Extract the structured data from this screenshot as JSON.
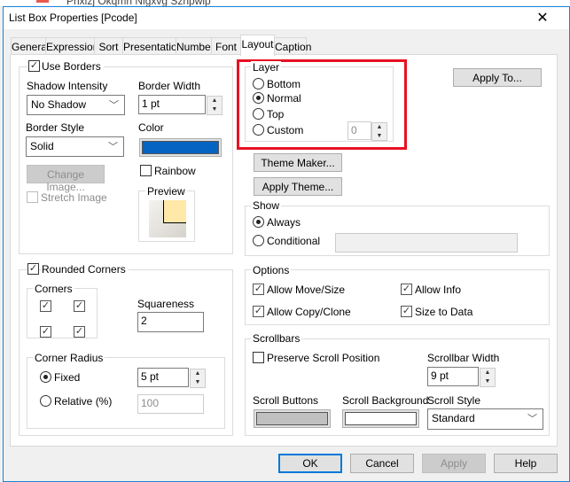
{
  "background": {
    "partial_text": "Pnxizj Okqmn Nlgxvg Szhpwip"
  },
  "window": {
    "title": "List Box Properties [Pcode]",
    "close": "✕"
  },
  "tabs": [
    {
      "label": "General"
    },
    {
      "label": "Expressions"
    },
    {
      "label": "Sort"
    },
    {
      "label": "Presentation"
    },
    {
      "label": "Number"
    },
    {
      "label": "Font"
    },
    {
      "label": "Layout",
      "selected": true
    },
    {
      "label": "Caption"
    }
  ],
  "borders": {
    "use_borders_label": "Use Borders",
    "use_borders": true,
    "shadow_label": "Shadow Intensity",
    "shadow_value": "No Shadow",
    "width_label": "Border Width",
    "width_value": "1 pt",
    "style_label": "Border Style",
    "style_value": "Solid",
    "color_label": "Color",
    "color": "#0563c1",
    "change_image": "Change Image...",
    "rainbow_label": "Rainbow",
    "rainbow": false,
    "stretch_label": "Stretch Image",
    "stretch": false,
    "preview_label": "Preview",
    "preview_fill": "#ffe8a8"
  },
  "rounded": {
    "label": "Rounded Corners",
    "checked": true,
    "corners_label": "Corners",
    "corners": [
      true,
      true,
      true,
      true
    ],
    "squareness_label": "Squareness",
    "squareness": "2",
    "radius_label": "Corner Radius",
    "fixed_label": "Fixed",
    "fixed_value": "5 pt",
    "relative_label": "Relative (%)",
    "relative_value": "100",
    "mode": "Fixed"
  },
  "layer": {
    "label": "Layer",
    "options": [
      "Bottom",
      "Normal",
      "Top",
      "Custom"
    ],
    "selected": "Normal",
    "custom_value": "0",
    "highlight": "#e81123"
  },
  "apply_to": "Apply To...",
  "theme_maker": "Theme Maker...",
  "apply_theme": "Apply Theme...",
  "show": {
    "label": "Show",
    "always": "Always",
    "conditional": "Conditional",
    "selected": "Always",
    "conditional_value": ""
  },
  "options": {
    "label": "Options",
    "items": [
      {
        "label": "Allow Move/Size",
        "checked": true
      },
      {
        "label": "Allow Info",
        "checked": true
      },
      {
        "label": "Allow Copy/Clone",
        "checked": true
      },
      {
        "label": "Size to Data",
        "checked": true
      }
    ]
  },
  "scrollbars": {
    "label": "Scrollbars",
    "preserve_label": "Preserve Scroll Position",
    "preserve": false,
    "width_label": "Scrollbar Width",
    "width_value": "9 pt",
    "buttons_label": "Scroll Buttons",
    "buttons_color": "#c0c0c0",
    "background_label": "Scroll Background",
    "background_color": "#ffffff",
    "style_label": "Scroll Style",
    "style_value": "Standard"
  },
  "footer": {
    "ok": "OK",
    "cancel": "Cancel",
    "apply": "Apply",
    "help": "Help"
  }
}
